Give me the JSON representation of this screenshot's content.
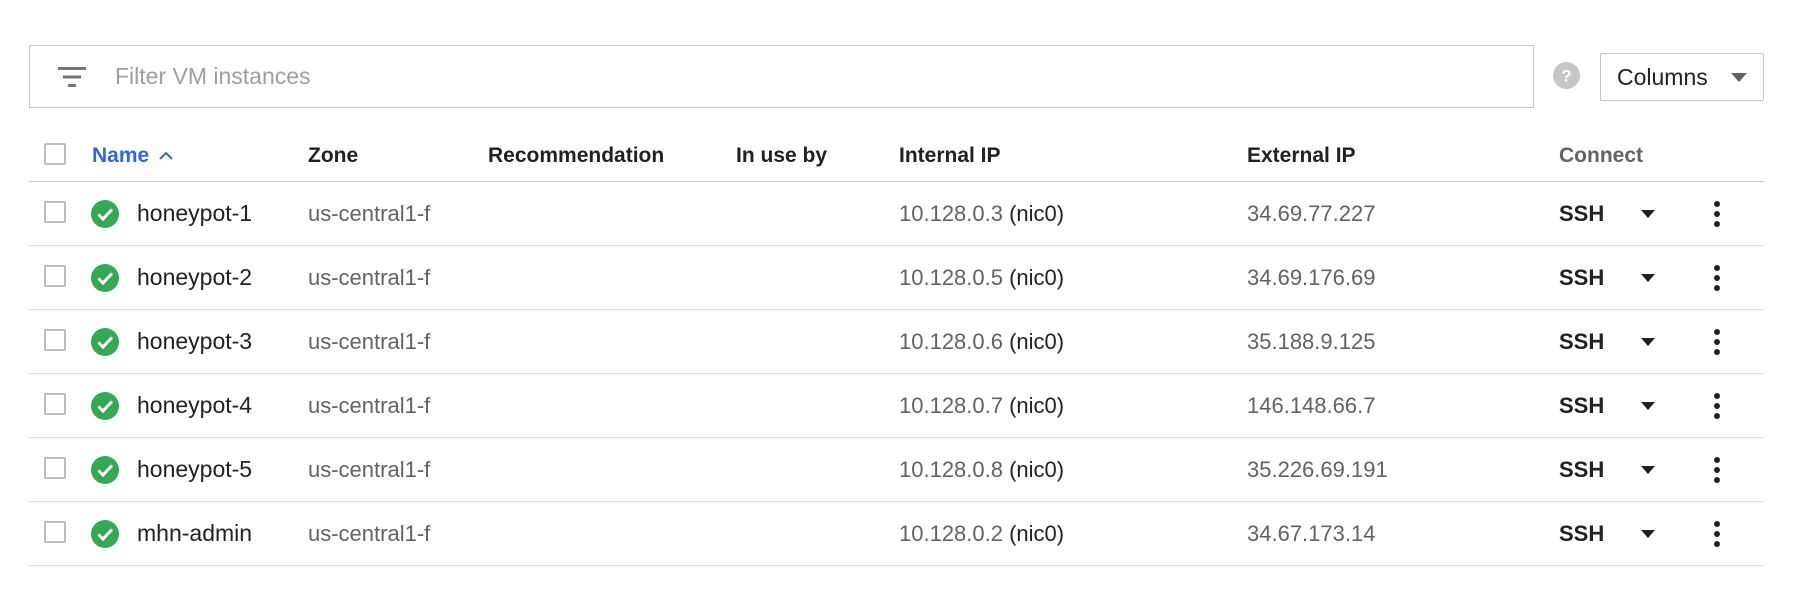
{
  "filter": {
    "placeholder": "Filter VM instances",
    "icon": "filter-icon"
  },
  "help": {
    "icon": "help-icon"
  },
  "columns_button": {
    "label": "Columns",
    "icon": "caret-down-icon"
  },
  "table": {
    "headers": {
      "name": "Name",
      "zone": "Zone",
      "recommendation": "Recommendation",
      "in_use_by": "In use by",
      "internal_ip": "Internal IP",
      "external_ip": "External IP",
      "connect": "Connect"
    },
    "sort": {
      "column": "Name",
      "direction": "ascending"
    },
    "rows": [
      {
        "status": "running",
        "name": "honeypot-1",
        "zone": "us-central1-f",
        "recommendation": "",
        "in_use_by": "",
        "internal_ip": "10.128.0.3",
        "internal_nic": "(nic0)",
        "external_ip": "34.69.77.227",
        "connect": "SSH"
      },
      {
        "status": "running",
        "name": "honeypot-2",
        "zone": "us-central1-f",
        "recommendation": "",
        "in_use_by": "",
        "internal_ip": "10.128.0.5",
        "internal_nic": "(nic0)",
        "external_ip": "34.69.176.69",
        "connect": "SSH"
      },
      {
        "status": "running",
        "name": "honeypot-3",
        "zone": "us-central1-f",
        "recommendation": "",
        "in_use_by": "",
        "internal_ip": "10.128.0.6",
        "internal_nic": "(nic0)",
        "external_ip": "35.188.9.125",
        "connect": "SSH"
      },
      {
        "status": "running",
        "name": "honeypot-4",
        "zone": "us-central1-f",
        "recommendation": "",
        "in_use_by": "",
        "internal_ip": "10.128.0.7",
        "internal_nic": "(nic0)",
        "external_ip": "146.148.66.7",
        "connect": "SSH"
      },
      {
        "status": "running",
        "name": "honeypot-5",
        "zone": "us-central1-f",
        "recommendation": "",
        "in_use_by": "",
        "internal_ip": "10.128.0.8",
        "internal_nic": "(nic0)",
        "external_ip": "35.226.69.191",
        "connect": "SSH"
      },
      {
        "status": "running",
        "name": "mhn-admin",
        "zone": "us-central1-f",
        "recommendation": "",
        "in_use_by": "",
        "internal_ip": "10.128.0.2",
        "internal_nic": "(nic0)",
        "external_ip": "34.67.173.14",
        "connect": "SSH"
      }
    ]
  },
  "colors": {
    "accent": "#3367d6",
    "status_ok": "#34a853",
    "border": "#dadce0",
    "muted_text": "#5f6368"
  }
}
